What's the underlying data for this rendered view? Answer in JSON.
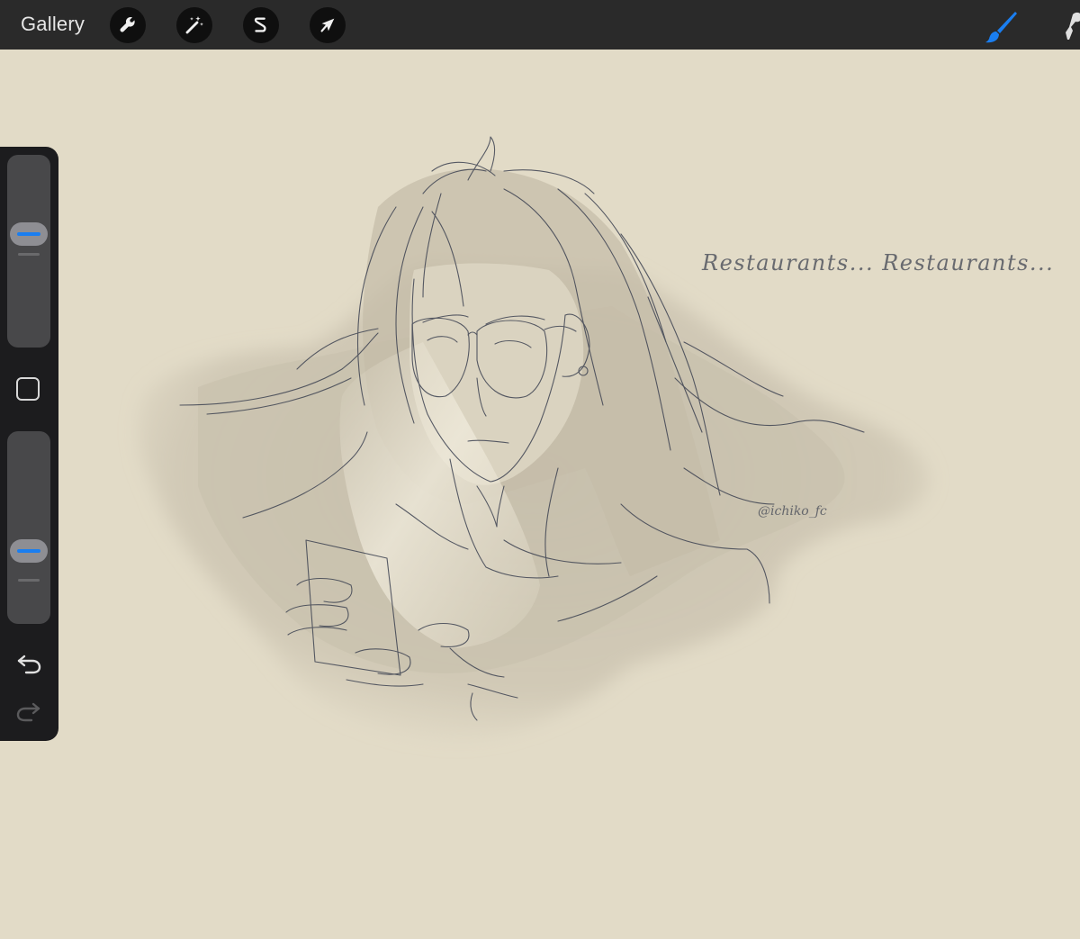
{
  "topbar": {
    "gallery_label": "Gallery",
    "tools": [
      {
        "name": "actions",
        "icon": "wrench-icon"
      },
      {
        "name": "adjustments",
        "icon": "magic-wand-icon"
      },
      {
        "name": "selection",
        "icon": "selection-s-icon"
      },
      {
        "name": "transform",
        "icon": "arrow-cursor-icon"
      }
    ],
    "right_tools": [
      {
        "name": "brush",
        "icon": "brush-icon",
        "active": true,
        "color": "#1a7ef0"
      },
      {
        "name": "smudge",
        "icon": "smudge-icon",
        "active": false
      }
    ]
  },
  "sidebar": {
    "brush_size_level": 0.61,
    "opacity_level": 0.35,
    "square_button": "modify-button",
    "undo": "undo-icon",
    "redo": "redo-icon"
  },
  "canvas": {
    "background": "#e2dbc7",
    "handwritten_text": "Restaurants... Restaurants...",
    "signature_text": "@ichiko_fc"
  },
  "colors": {
    "topbar": "#2a2a2a",
    "sidebar": "#1c1c1e",
    "accent": "#1a7ef0",
    "sketch_line": "#3b4150"
  }
}
